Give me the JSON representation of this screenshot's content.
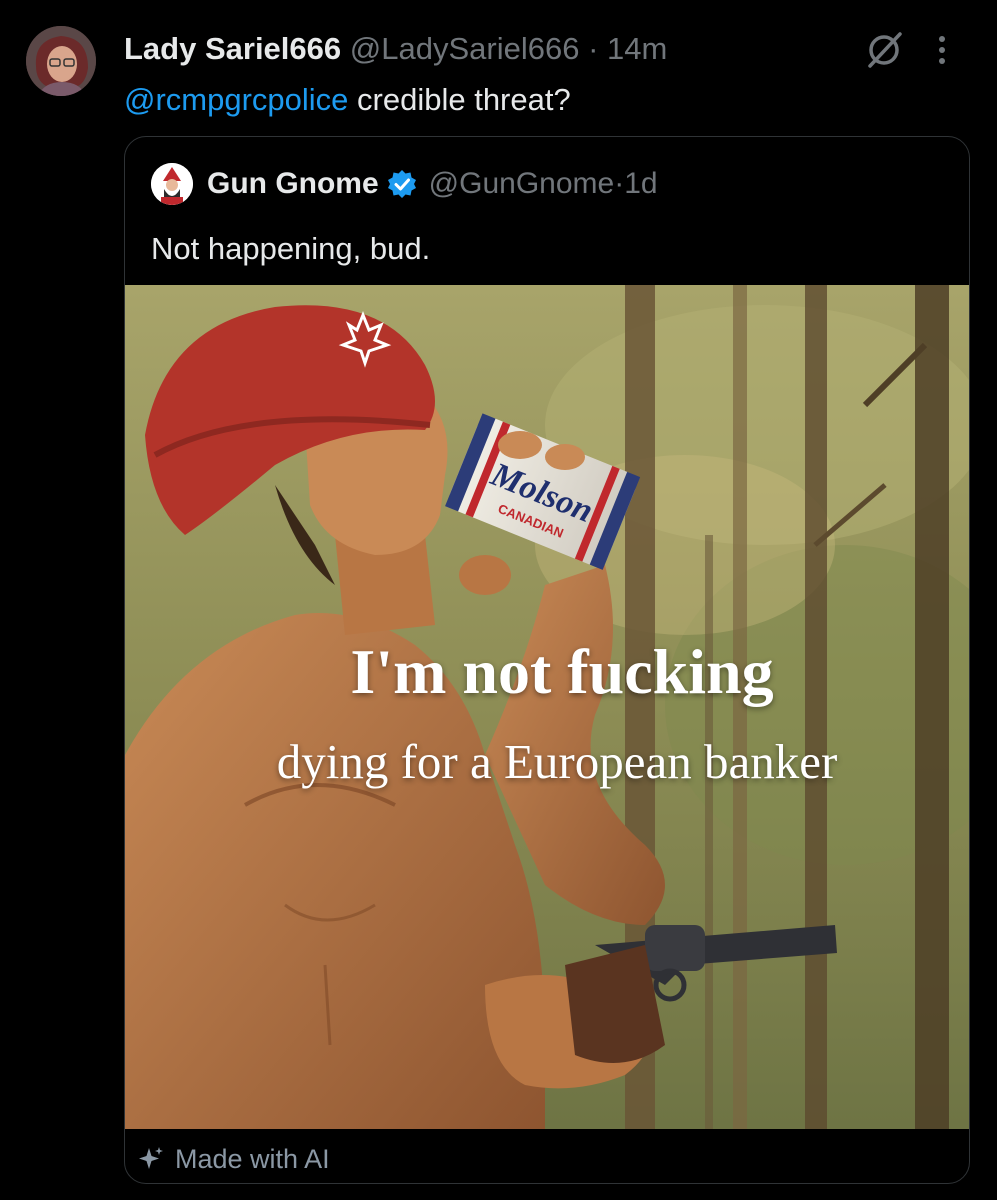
{
  "tweet": {
    "author": {
      "display_name": "Lady Sariel666",
      "handle": "@LadySariel666",
      "separator": "·",
      "time": "14m"
    },
    "text": {
      "mention": "@rcmpgrcpolice",
      "body": " credible threat?"
    },
    "actions": {
      "grok_icon": "grok-icon",
      "more_icon": "more-vertical-icon"
    }
  },
  "quoted_tweet": {
    "author": {
      "display_name": "Gun Gnome",
      "verified": true,
      "handle": "@GunGnome",
      "separator": "·",
      "time": "1d"
    },
    "text": "Not happening, bud.",
    "media": {
      "caption_line_1": "I'm not fucking",
      "caption_line_2": "dying for a European banker",
      "can_brand": "Molson",
      "can_subtext": "CANADIAN"
    },
    "ai_label": "Made with AI"
  },
  "colors": {
    "background": "#000000",
    "link": "#1d9bf0",
    "muted": "#71767b",
    "verified": "#1d9bf0",
    "border": "#2f3336"
  }
}
